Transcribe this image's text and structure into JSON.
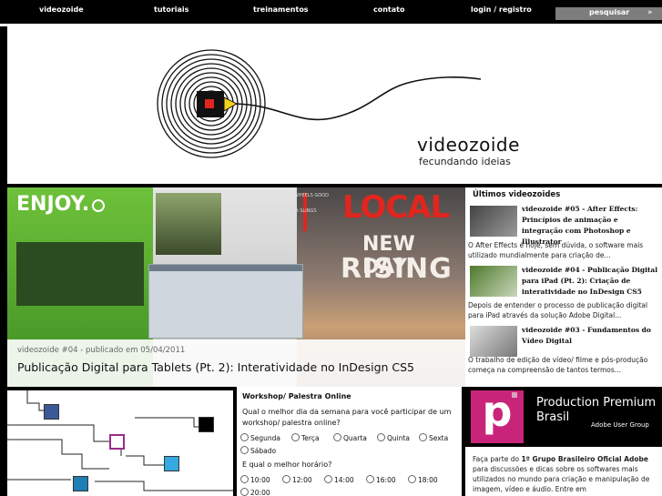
{
  "nav": {
    "items": [
      "videozoide",
      "tutoriais",
      "treinamentos",
      "contato",
      "login / registro"
    ],
    "search_label": "pesquisar"
  },
  "header": {
    "brand": "videozoide",
    "tagline": "fecundando ideias"
  },
  "hero": {
    "meta": "videozoide #04 - publicado em 05/04/2011",
    "title": "Publicação Digital para Tablets (Pt. 2): Interatividade no InDesign CS5",
    "enjoy": "ENJOY.",
    "local": "LOCAL",
    "new_day": "NEW DAY",
    "rising": "RISING",
    "two_wheels": "2 WHEELS GOOD",
    "sea_slings": "SEA SLINGS"
  },
  "sidebar": {
    "heading": "Últimos videozoides",
    "items": [
      {
        "title": "videozoide #05 - After Effects: Princípios de animação e integração com Photoshop e Illustrator",
        "desc": "O After Effects é hoje, sem dúvida, o software mais utilizado mundialmente para criação de..."
      },
      {
        "title": "videozoide #04 - Publicação Digital para iPad (Pt. 2): Criação de interatividade no InDesign CS5",
        "desc": "Depois de entender o processo de publicação digital para iPad através da solução Adobe Digital..."
      },
      {
        "title": "videozoide #03 - Fundamentos do Vídeo Digital",
        "desc": "O trabalho de edição de vídeo/ filme e pós-produção começa na compreensão de tantos termos..."
      }
    ]
  },
  "poll": {
    "heading": "Workshop/ Palestra Online",
    "question1": "Qual o melhor dia da semana para você participar de um workshop/ palestra online?",
    "days": [
      "Segunda",
      "Terça",
      "Quarta",
      "Quinta",
      "Sexta",
      "Sábado"
    ],
    "question2": "E qual o melhor horário?",
    "times": [
      "10:00",
      "12:00",
      "14:00",
      "16:00",
      "18:00",
      "20:00"
    ]
  },
  "production_premium": {
    "logo_letter": "p",
    "title_line1": "Production Premium",
    "title_line2": "Brasil",
    "subtitle": "Adobe User Group",
    "text_prefix": "Faça parte do ",
    "text_bold": "1º Grupo Brasileiro Oficial Adobe",
    "text_rest": " para discussões e dicas sobre os softwares mais utilizados no mundo para criação e manipulação de imagem, vídeo e áudio. Entre em"
  },
  "colors": {
    "nav_bg": "#000000",
    "search_bg": "#7d7d7d",
    "accent_magenta": "#c8257a",
    "local_red": "#e0261e",
    "hero_green": "#6ec13a"
  },
  "icons": [
    "facebook-icon",
    "flickr-icon",
    "twitter-icon",
    "linkedin-icon",
    "delicious-icon",
    "search-icon"
  ]
}
